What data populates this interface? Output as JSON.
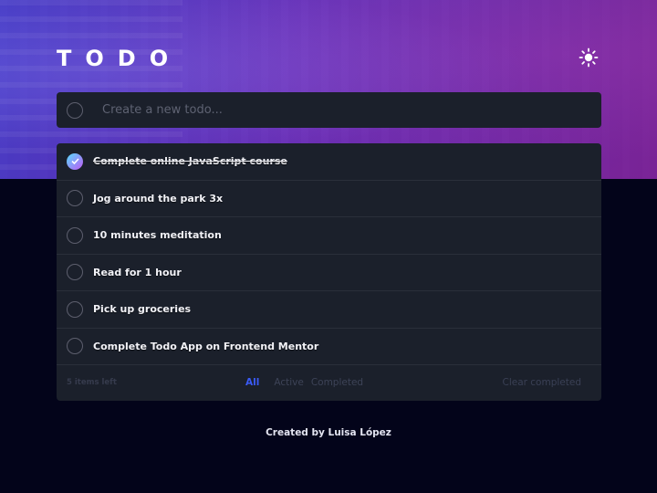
{
  "header": {
    "title": "TODO",
    "theme_toggle_icon": "sun-icon"
  },
  "new_todo": {
    "placeholder": "Create a new todo...",
    "value": ""
  },
  "todos": [
    {
      "label": "Complete online JavaScript course",
      "completed": true
    },
    {
      "label": "Jog around the park 3x",
      "completed": false
    },
    {
      "label": "10 minutes meditation",
      "completed": false
    },
    {
      "label": "Read for 1 hour",
      "completed": false
    },
    {
      "label": "Pick up groceries",
      "completed": false
    },
    {
      "label": "Complete Todo App on Frontend Mentor",
      "completed": false
    }
  ],
  "footer": {
    "items_left": "5 items left",
    "filters": [
      {
        "label": "All",
        "active": true
      },
      {
        "label": "Active",
        "active": false
      },
      {
        "label": "Completed",
        "active": false
      }
    ],
    "clear_label": "Clear completed"
  },
  "credit": "Created by Luisa López",
  "colors": {
    "accent": "#3a5af5",
    "check_gradient_start": "#57ddff",
    "check_gradient_end": "#c058f3",
    "card_bg": "#1b202b",
    "page_bg": "#03041a"
  }
}
